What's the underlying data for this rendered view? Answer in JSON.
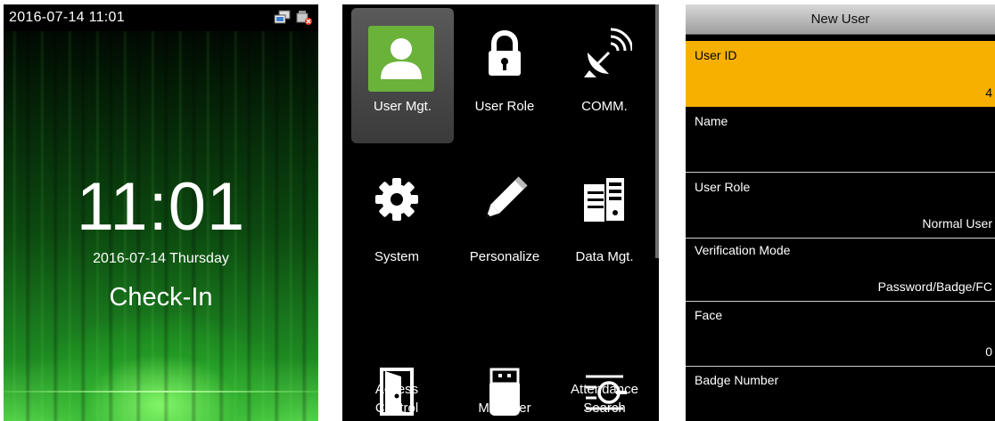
{
  "standby": {
    "status_datetime": "2016-07-14 11:01",
    "clock": "11:01",
    "date_weekday": "2016-07-14  Thursday",
    "attendance_state": "Check-In",
    "status_icons": [
      "network-icon",
      "usb-icon"
    ]
  },
  "menu": {
    "items": [
      {
        "label": "User Mgt.",
        "icon": "user-icon",
        "selected": true
      },
      {
        "label": "User Role",
        "icon": "lock-icon"
      },
      {
        "label": "COMM.",
        "icon": "satellite-icon"
      },
      {
        "label": "System",
        "icon": "gear-icon"
      },
      {
        "label": "Personalize",
        "icon": "pencil-icon"
      },
      {
        "label": "Data Mgt.",
        "icon": "server-icon"
      },
      {
        "label": "Access\nControl",
        "icon": "door-icon"
      },
      {
        "label": "USB\nManager",
        "icon": "usb-drive-icon"
      },
      {
        "label": "Attendance\nSearch",
        "icon": "attendance-search-icon"
      }
    ]
  },
  "new_user": {
    "title": "New User",
    "fields": [
      {
        "label": "User ID",
        "value": "4",
        "selected": true
      },
      {
        "label": "Name",
        "value": ""
      },
      {
        "label": "User Role",
        "value": "Normal User"
      },
      {
        "label": "Verification Mode",
        "value": "Password/Badge/FC"
      },
      {
        "label": "Face",
        "value": "0"
      },
      {
        "label": "Badge Number",
        "value": ""
      }
    ]
  },
  "colors": {
    "selected_field": "#f8b000",
    "user_icon_bg": "#6ab23a",
    "menu_highlight": "#4a4a4a"
  }
}
